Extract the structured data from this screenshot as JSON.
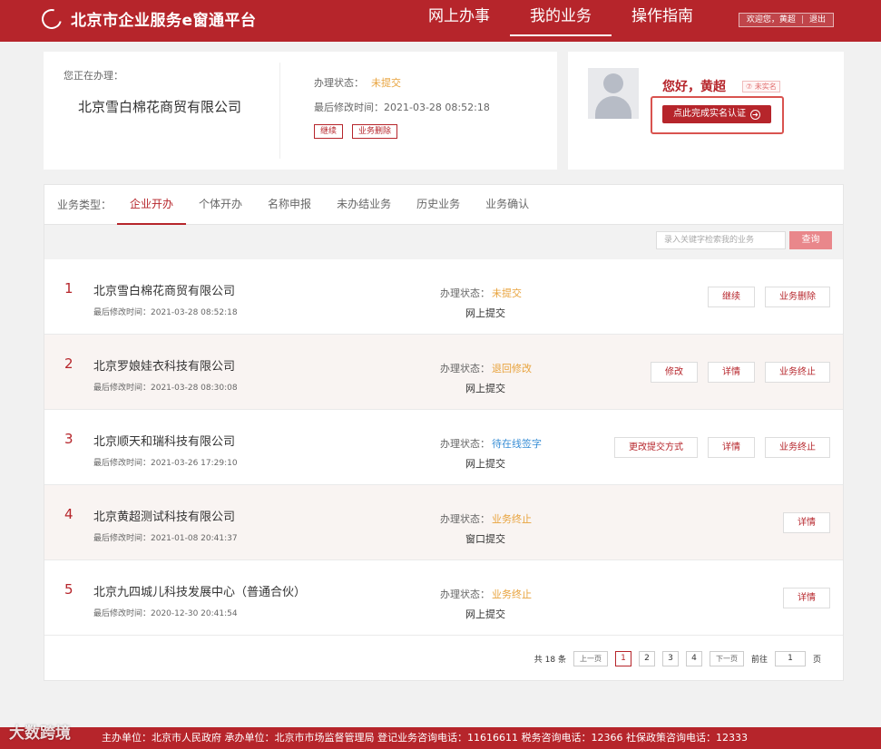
{
  "header": {
    "logo_text": "北京市企业服务e窗通平台",
    "nav": [
      "网上办事",
      "我的业务",
      "操作指南"
    ],
    "welcome": "欢迎您，黄超",
    "logout": "退出"
  },
  "current": {
    "label": "您正在办理：",
    "company": "北京雪白棉花商贸有限公司",
    "status_label": "办理状态：",
    "status_value": "未提交",
    "time": "最后修改时间：2021-03-28 08:52:18",
    "btn_continue": "继续",
    "btn_delete": "业务删除"
  },
  "user": {
    "greeting": "您好，黄超",
    "badge": "⑦ 未实名",
    "verify_btn": "点此完成实名认证"
  },
  "tabs": {
    "label": "业务类型：",
    "items": [
      "企业开办",
      "个体开办",
      "名称申报",
      "未办结业务",
      "历史业务",
      "业务确认"
    ]
  },
  "search": {
    "placeholder": "录入关键字检索我的业务",
    "button": "查询"
  },
  "rows": [
    {
      "no": "1",
      "name": "北京雪白棉花商贸有限公司",
      "time": "最后修改时间：2021-03-28 08:52:18",
      "status_label": "办理状态：",
      "status": "未提交",
      "method": "网上提交",
      "btns": [
        "继续",
        "业务删除"
      ]
    },
    {
      "no": "2",
      "name": "北京罗娘娃衣科技有限公司",
      "time": "最后修改时间：2021-03-28 08:30:08",
      "status_label": "办理状态：",
      "status": "退回修改",
      "method": "网上提交",
      "btns": [
        "修改",
        "详情",
        "业务终止"
      ]
    },
    {
      "no": "3",
      "name": "北京顺天和瑞科技有限公司",
      "time": "最后修改时间：2021-03-26 17:29:10",
      "status_label": "办理状态：",
      "status": "待在线签字",
      "method": "网上提交",
      "btns": [
        "更改提交方式",
        "详情",
        "业务终止"
      ]
    },
    {
      "no": "4",
      "name": "北京黄超测试科技有限公司",
      "time": "最后修改时间：2021-01-08 20:41:37",
      "status_label": "办理状态：",
      "status": "业务终止",
      "method": "窗口提交",
      "btns": [
        "详情"
      ]
    },
    {
      "no": "5",
      "name": "北京九四城儿科技发展中心（普通合伙）",
      "time": "最后修改时间：2020-12-30 20:41:54",
      "status_label": "办理状态：",
      "status": "业务终止",
      "method": "网上提交",
      "btns": [
        "详情"
      ]
    }
  ],
  "pager": {
    "total": "共 18 条",
    "prev": "上一页",
    "pages": [
      "1",
      "2",
      "3",
      "4"
    ],
    "next": "下一页",
    "goto": "前往",
    "goto_value": "1",
    "page_unit": "页"
  },
  "footer": "主办单位：北京市人民政府   承办单位：北京市市场监督管理局   登记业务咨询电话：11616611   税务咨询电话：12366   社保政策咨询电话：12333",
  "watermark": "大数跨境"
}
